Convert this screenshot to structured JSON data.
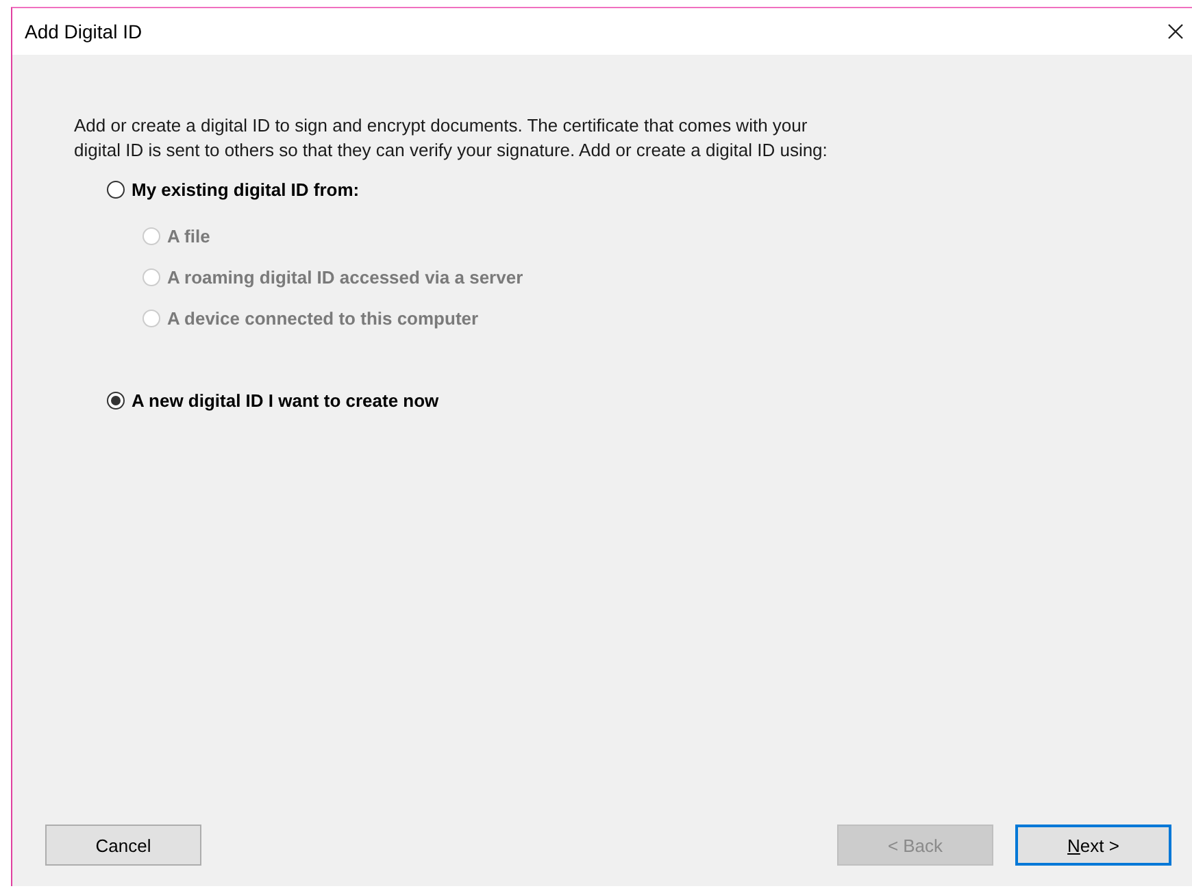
{
  "window": {
    "title": "Add Digital ID"
  },
  "intro": "Add or create a digital ID to sign and encrypt documents. The certificate that comes with your digital ID is sent to others so that they can verify your signature. Add or create a digital ID using:",
  "options": [
    {
      "label": "My existing digital ID from:",
      "selected": false,
      "disabled": false,
      "children": [
        {
          "label": "A file",
          "selected": false,
          "disabled": true
        },
        {
          "label": "A roaming digital ID accessed via a server",
          "selected": false,
          "disabled": true
        },
        {
          "label": "A device connected to this computer",
          "selected": false,
          "disabled": true
        }
      ]
    },
    {
      "label": "A new digital ID I want to create now",
      "selected": true,
      "disabled": false
    }
  ],
  "buttons": [
    {
      "label": "Cancel",
      "disabled": false,
      "focused": false,
      "mnemonic": false
    },
    {
      "label": "< Back",
      "disabled": true,
      "focused": false,
      "mnemonic": false
    },
    {
      "label": "Next >",
      "disabled": false,
      "focused": true,
      "mnemonic": true
    }
  ]
}
